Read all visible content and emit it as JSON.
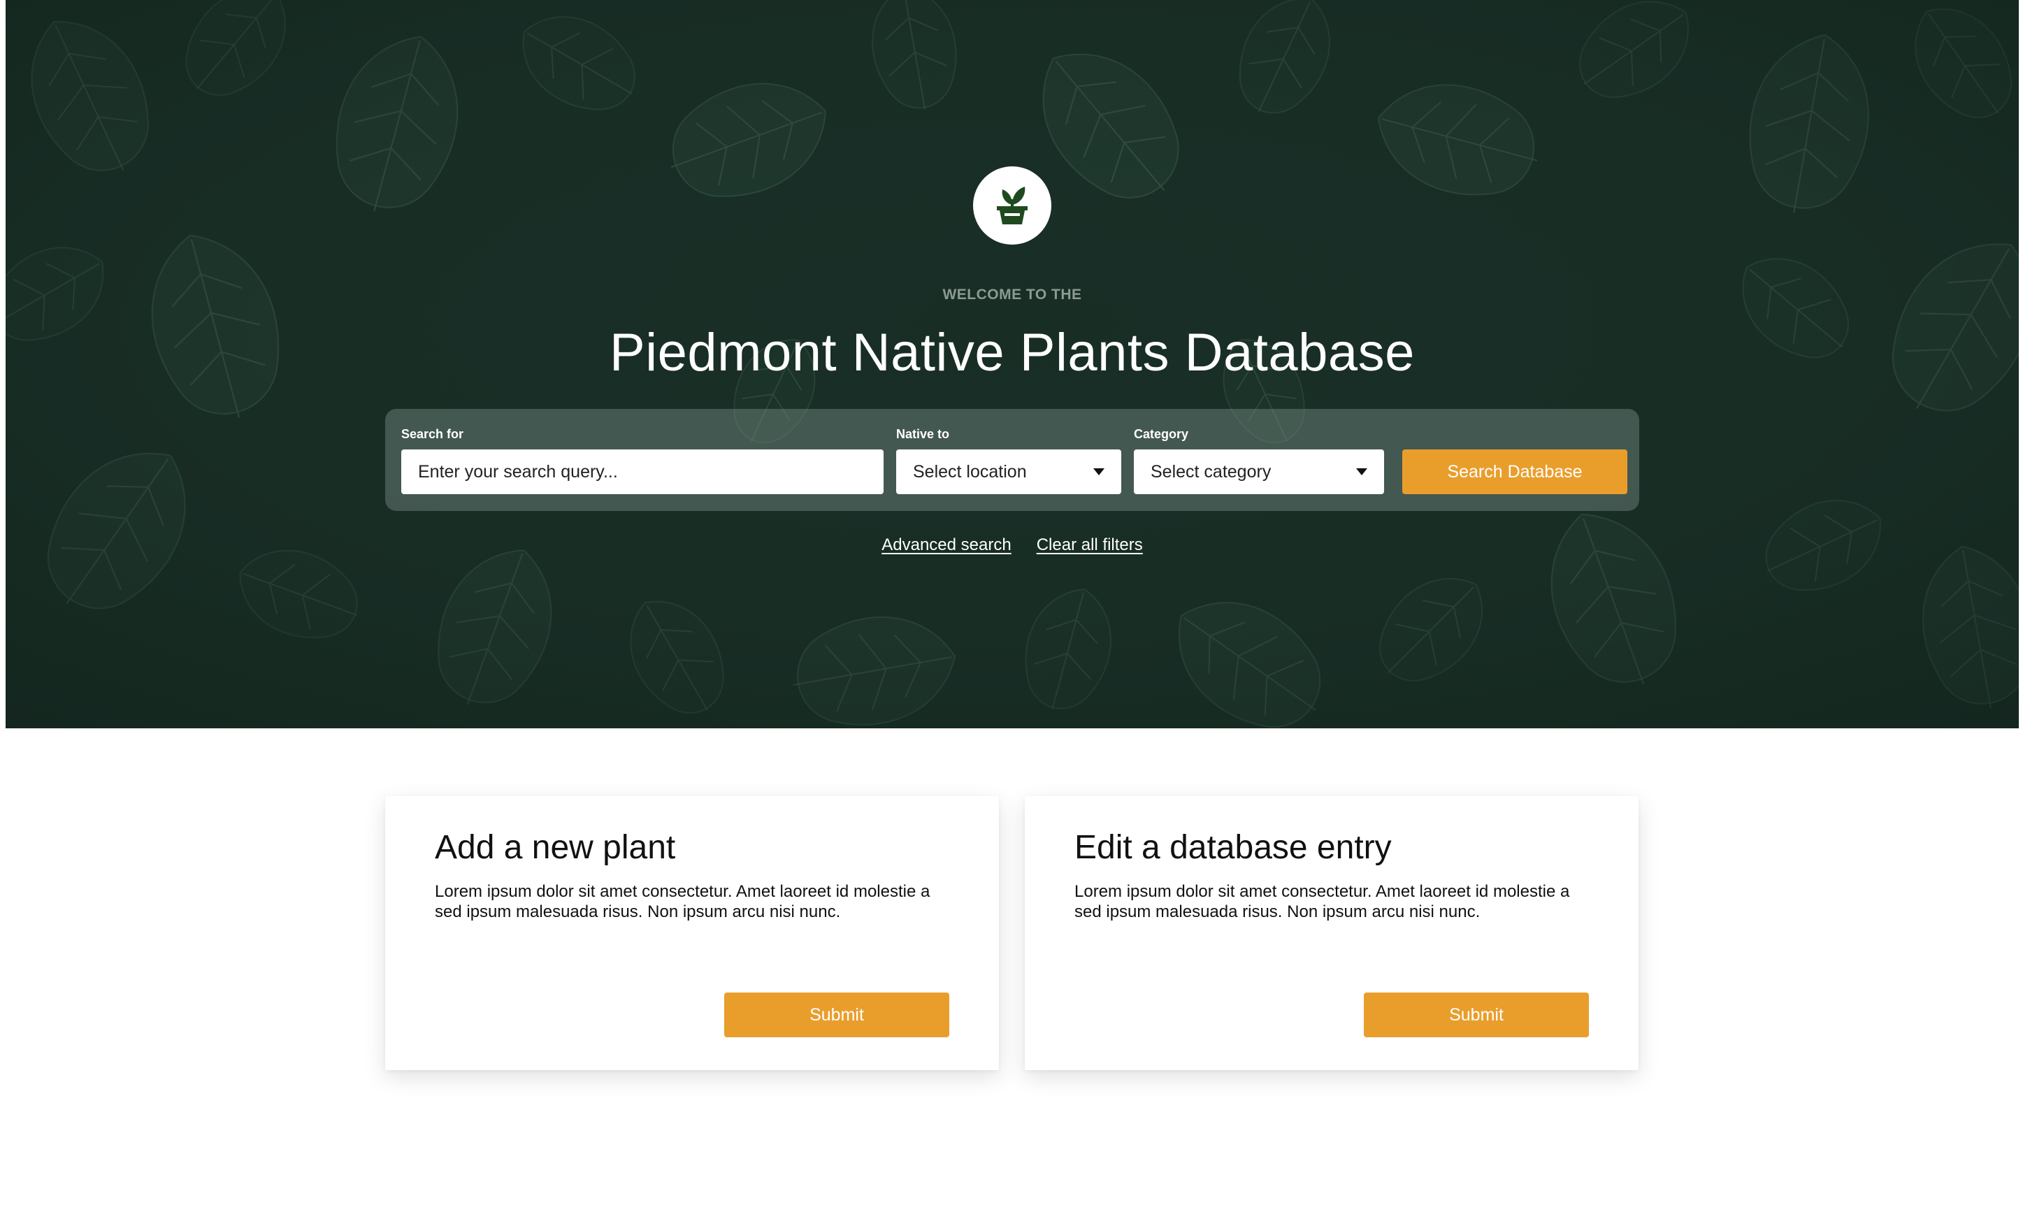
{
  "colors": {
    "hero_bg": "#1b3129",
    "accent": "#e99e2c",
    "logo_green": "#1f4a1f"
  },
  "hero": {
    "logo_icon": "potted-plant-icon",
    "eyebrow": "WELCOME TO THE",
    "title": "Piedmont Native Plants Database",
    "search": {
      "search_label": "Search for",
      "search_placeholder": "Enter your search query...",
      "native_label": "Native to",
      "native_value": "Select location",
      "category_label": "Category",
      "category_value": "Select category",
      "button_label": "Search Database"
    },
    "links": {
      "advanced": "Advanced search",
      "clear": "Clear all filters"
    }
  },
  "cards": [
    {
      "title": "Add a new plant",
      "body": "Lorem ipsum dolor sit amet consectetur. Amet laoreet id molestie a sed ipsum malesuada risus. Non ipsum arcu nisi nunc.",
      "button_label": "Submit"
    },
    {
      "title": "Edit a database entry",
      "body": "Lorem ipsum dolor sit amet consectetur. Amet laoreet id molestie a sed ipsum malesuada risus. Non ipsum arcu nisi nunc.",
      "button_label": "Submit"
    }
  ]
}
